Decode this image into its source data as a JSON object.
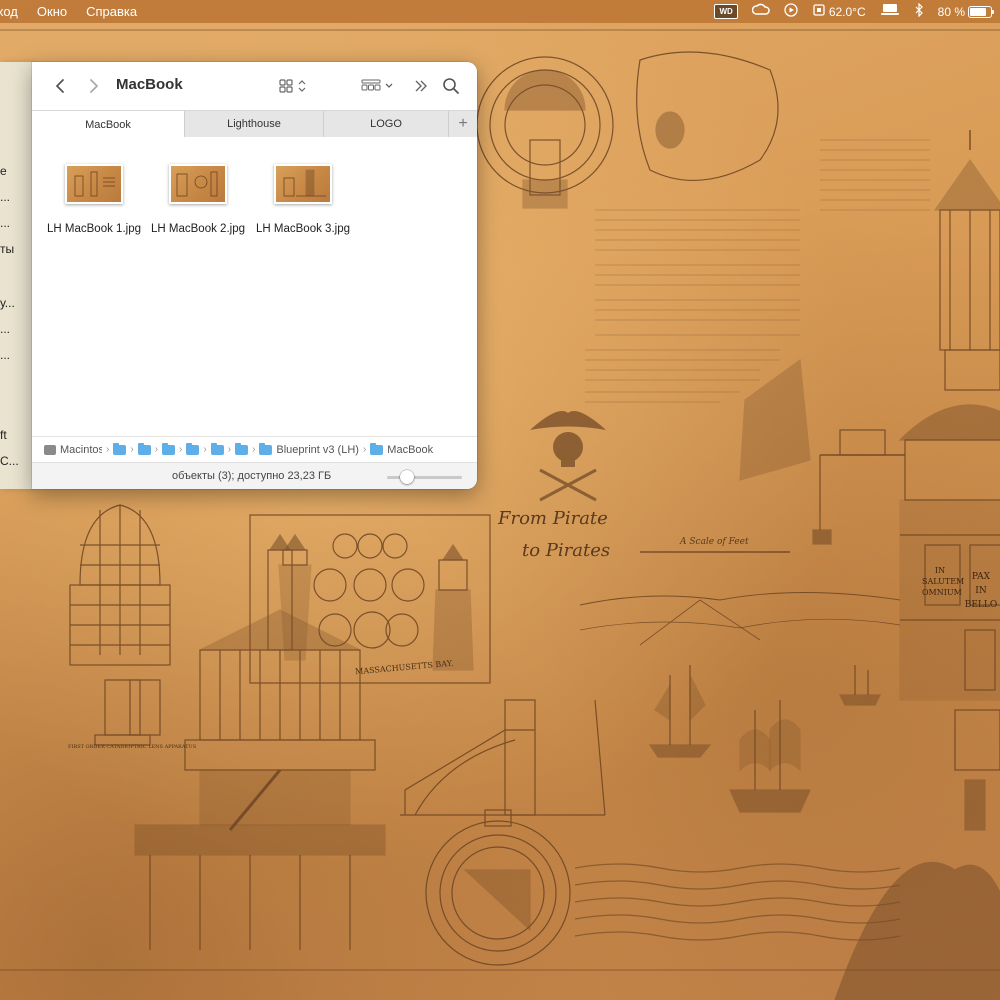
{
  "menubar": {
    "items": [
      "ход",
      "Окно",
      "Справка"
    ],
    "wd_label": "WD",
    "temperature": "62.0°C",
    "battery_text": "80 %",
    "battery_level": 0.8
  },
  "left_window": {
    "fragments": [
      "е",
      "...",
      "...",
      "ты",
      "у...",
      "...",
      "...",
      "ft",
      "С..."
    ]
  },
  "finder": {
    "title": "MacBook",
    "tabs": [
      {
        "label": "MacBook",
        "active": true
      },
      {
        "label": "Lighthouse",
        "active": false
      },
      {
        "label": "LOGO",
        "active": false
      }
    ],
    "files": [
      {
        "name": "LH MacBook 1.jpg"
      },
      {
        "name": "LH MacBook 2.jpg"
      },
      {
        "name": "LH MacBook 3.jpg"
      }
    ],
    "path": {
      "root": "Macintosh HD",
      "folder": "Blueprint v3 (LH)",
      "current": "MacBook"
    },
    "status": "объекты (3); доступно 23,23 ГБ"
  },
  "wallpaper": {
    "script_text": [
      "From Pirate",
      "to Pirates"
    ],
    "tower_signs": [
      "IN",
      "SALUTEM",
      "OMNIUM",
      "PAX",
      "IN",
      "BELLO"
    ],
    "caption_left": "FIRST ORDER CATADIOPTRIC LENS APPARATUS",
    "caption_mid": "MASSACHUSETTS BAY.",
    "scale_text": "A Scale of Feet"
  },
  "colors": {
    "menubar": "#be7837",
    "accent_folder": "#5eaee8",
    "parchment": "#d99c57",
    "ink": "#6b4322"
  }
}
